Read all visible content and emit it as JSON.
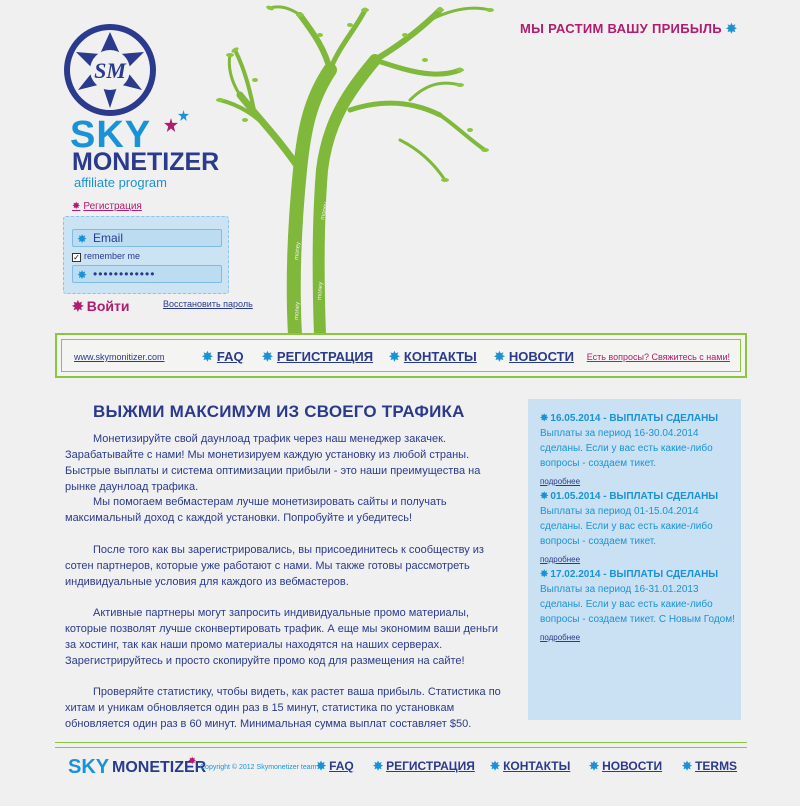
{
  "brand": {
    "logo_letters": "SM",
    "sky": "SKY",
    "monetizer": "MONETIZER",
    "tagline": "affiliate program"
  },
  "slogan": "МЫ РАСТИМ ВАШУ ПРИБЫЛЬ",
  "tree_words": [
    "money",
    "money",
    "money",
    "money"
  ],
  "login": {
    "register_link": "Регистрация",
    "email_placeholder": "Email",
    "remember_label": "remember me",
    "password_value": "••••••••••••",
    "submit_label": "Войти",
    "forgot_link": "Восстановить пароль"
  },
  "nav": {
    "url": "www.skymonitizer.com",
    "items": [
      {
        "label": "FAQ"
      },
      {
        "label": "РЕГИСТРАЦИЯ"
      },
      {
        "label": "КОНТАКТЫ"
      },
      {
        "label": "НОВОСТИ"
      }
    ],
    "contact_link": "Есть вопросы? Свяжитесь с нами!"
  },
  "main": {
    "title": "ВЫЖМИ МАКСИМУМ ИЗ СВОЕГО ТРАФИКА",
    "paragraphs": [
      "Монетизируйте свой даунлоад трафик через наш менеджер закачек. Зарабатывайте с нами! Мы монетизируем каждую установку из любой страны. Быстрые выплаты и система оптимизации прибыли - это наши преимущества на рынке даунлоад трафика.",
      "Мы помогаем вебмастерам лучше монетизировать сайты и получать максимальный доход с каждой установки. Попробуйте и убедитесь!",
      "После того как вы зарегистрировались, вы присоединитесь к сообществу из сотен партнеров, которые уже работают с нами. Мы также готовы рассмотреть индивидуальные условия для каждого из вебмастеров.",
      "Активные партнеры могут запросить индивидуальные промо материалы, которые позволят лучше сконвертировать трафик. А еще мы экономим ваши деньги за хостинг, так как наши промо материалы находятся на наших серверах. Зарегистрируйтесь и просто скопируйте промо код для размещения на сайте!",
      "Проверяйте статистику, чтобы видеть, как растет ваша прибыль. Статистика по хитам и уникам обновляется один раз в 15 минут, статистика по установкам обновляется один раз в 60 минут. Минимальная сумма выплат составляет $50."
    ]
  },
  "news": [
    {
      "title": "16.05.2014 - ВЫПЛАТЫ СДЕЛАНЫ",
      "body": "Выплаты за период 16-30.04.2014 сделаны. Если у вас есть какие-либо вопросы - создаем тикет.",
      "more": "подробнее"
    },
    {
      "title": "01.05.2014 - ВЫПЛАТЫ СДЕЛАНЫ",
      "body": "Выплаты за период 01-15.04.2014 сделаны. Если у вас есть какие-либо вопросы - создаем тикет.",
      "more": "подробнее"
    },
    {
      "title": "17.02.2014 - ВЫПЛАТЫ СДЕЛАНЫ",
      "body": "Выплаты за период 16-31.01.2013 сделаны. Если у вас есть какие-либо вопросы - создаем тикет. С Новым Годом!",
      "more": "подробнее"
    }
  ],
  "footer": {
    "sky": "SKY",
    "monetizer": "MONETIZER",
    "copyright": "Copyright © 2012 Skymonetizer team",
    "items": [
      {
        "label": "FAQ"
      },
      {
        "label": "РЕГИСТРАЦИЯ"
      },
      {
        "label": "КОНТАКТЫ"
      },
      {
        "label": "НОВОСТИ"
      },
      {
        "label": "TERMS"
      }
    ]
  },
  "colors": {
    "navy": "#2a3a8c",
    "blue": "#1a93d6",
    "magenta": "#b01c6e",
    "green": "#8cc63f",
    "light_blue": "#c9e1f2"
  }
}
